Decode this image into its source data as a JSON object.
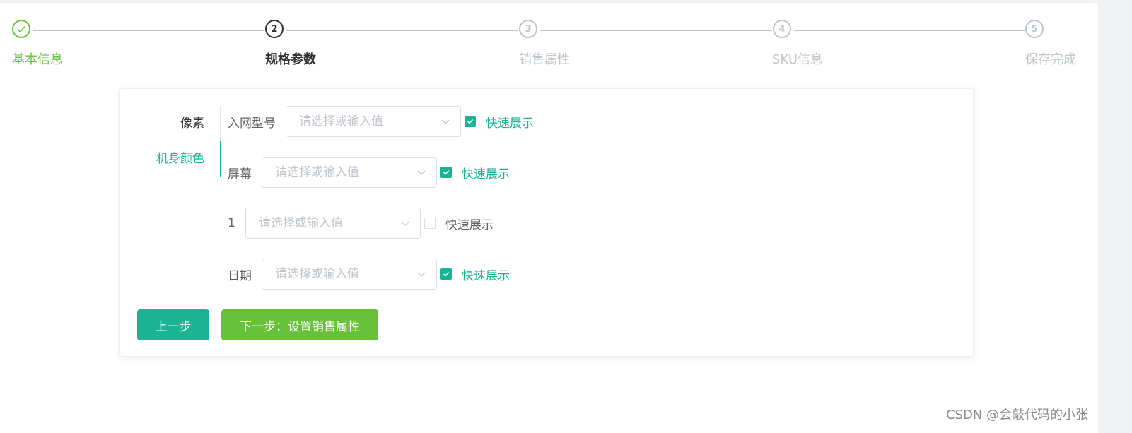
{
  "steps": [
    {
      "number": "1",
      "title": "基本信息",
      "status": "success"
    },
    {
      "number": "2",
      "title": "规格参数",
      "status": "process"
    },
    {
      "number": "3",
      "title": "销售属性",
      "status": "wait"
    },
    {
      "number": "4",
      "title": "SKU信息",
      "status": "wait"
    },
    {
      "number": "5",
      "title": "保存完成",
      "status": "wait"
    }
  ],
  "tabs": [
    {
      "label": "像素",
      "active": false
    },
    {
      "label": "机身颜色",
      "active": true
    }
  ],
  "params": [
    {
      "label": "入网型号",
      "placeholder": "请选择或输入值",
      "checkbox_label": "快速展示",
      "checked": true
    },
    {
      "label": "屏幕",
      "placeholder": "请选择或输入值",
      "checkbox_label": "快速展示",
      "checked": true
    },
    {
      "label": "1",
      "placeholder": "请选择或输入值",
      "checkbox_label": "快速展示",
      "checked": false
    },
    {
      "label": "日期",
      "placeholder": "请选择或输入值",
      "checkbox_label": "快速展示",
      "checked": true
    }
  ],
  "buttons": {
    "prev_label": "上一步",
    "next_label": "下一步：设置销售属性"
  },
  "watermark": "CSDN @会敲代码的小张",
  "colors": {
    "primary": "#1ab394",
    "success": "#67c23a",
    "wait": "#c0c4cc",
    "process": "#303133"
  }
}
